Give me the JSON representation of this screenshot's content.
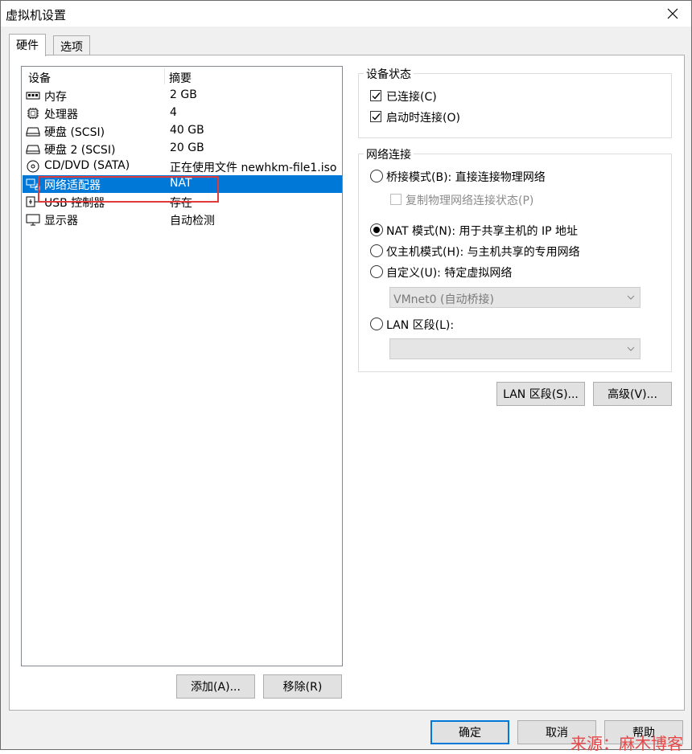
{
  "window": {
    "title": "虚拟机设置"
  },
  "tabs": [
    {
      "label": "硬件"
    },
    {
      "label": "选项"
    }
  ],
  "device_list": {
    "columns": {
      "device": "设备",
      "summary": "摘要"
    },
    "rows": [
      {
        "name": "内存",
        "summary": "2 GB",
        "icon": "memory-icon"
      },
      {
        "name": "处理器",
        "summary": "4",
        "icon": "processor-icon"
      },
      {
        "name": "硬盘 (SCSI)",
        "summary": "40 GB",
        "icon": "hard-disk-icon"
      },
      {
        "name": "硬盘 2 (SCSI)",
        "summary": "20 GB",
        "icon": "hard-disk-icon"
      },
      {
        "name": "CD/DVD (SATA)",
        "summary": "正在使用文件 newhkm-file1.iso",
        "icon": "cd-dvd-icon"
      },
      {
        "name": "网络适配器",
        "summary": "NAT",
        "icon": "network-adapter-icon",
        "selected": true
      },
      {
        "name": "USB 控制器",
        "summary": "存在",
        "icon": "usb-icon"
      },
      {
        "name": "显示器",
        "summary": "自动检测",
        "icon": "monitor-icon"
      }
    ]
  },
  "list_buttons": {
    "add": "添加(A)...",
    "remove": "移除(R)"
  },
  "device_status": {
    "title": "设备状态",
    "connected": {
      "label": "已连接(C)",
      "checked": true
    },
    "connect_at_power_on": {
      "label": "启动时连接(O)",
      "checked": true
    }
  },
  "network_connection": {
    "title": "网络连接",
    "bridged": {
      "label": "桥接模式(B): 直接连接物理网络",
      "checked": false
    },
    "replicate": {
      "label": "复制物理网络连接状态(P)",
      "checked": false,
      "disabled": true
    },
    "nat": {
      "label": "NAT 模式(N): 用于共享主机的 IP 地址",
      "checked": true
    },
    "host_only": {
      "label": "仅主机模式(H): 与主机共享的专用网络",
      "checked": false
    },
    "custom": {
      "label": "自定义(U): 特定虚拟网络",
      "checked": false
    },
    "custom_select": {
      "value": "VMnet0 (自动桥接)"
    },
    "lan_segment": {
      "label": "LAN 区段(L):",
      "checked": false
    },
    "lan_select": {
      "value": ""
    }
  },
  "network_buttons": {
    "lan_segments": "LAN 区段(S)...",
    "advanced": "高级(V)..."
  },
  "footer": {
    "ok": "确定",
    "cancel": "取消",
    "help": "帮助"
  },
  "watermark": "来源：麻木博客",
  "colors": {
    "selection": "#0078d7",
    "highlight_box": "#e23a3a",
    "watermark": "#e54848"
  }
}
